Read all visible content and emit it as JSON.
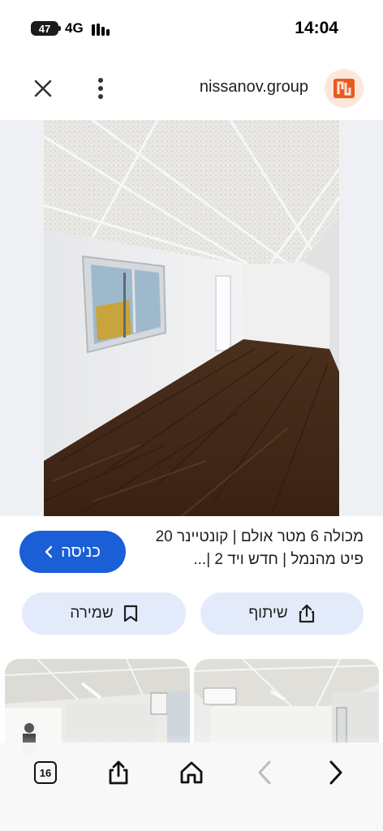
{
  "status_bar": {
    "battery": "47",
    "network": "4G",
    "time": "14:04"
  },
  "header": {
    "site_name": "nissanov.group",
    "close_icon": "close-icon",
    "menu_icon": "more-vertical-icon",
    "logo_icon": "site-logo-icon"
  },
  "result": {
    "caption": "מכולה 6 מטר אולם | קונטיינר 20 פיט מהנמל | חדש ויד 2 |...",
    "visit_label": "כניסה",
    "save_label": "שמירה",
    "share_label": "שיתוף"
  },
  "bottom_bar": {
    "tabs_count": "16",
    "icons": [
      "tabs-icon",
      "share-icon",
      "home-icon",
      "back-icon",
      "forward-icon"
    ]
  },
  "colors": {
    "accent": "#1a5fd6",
    "chip_bg": "#e3ebfb",
    "logo": "#ea5a1e"
  }
}
